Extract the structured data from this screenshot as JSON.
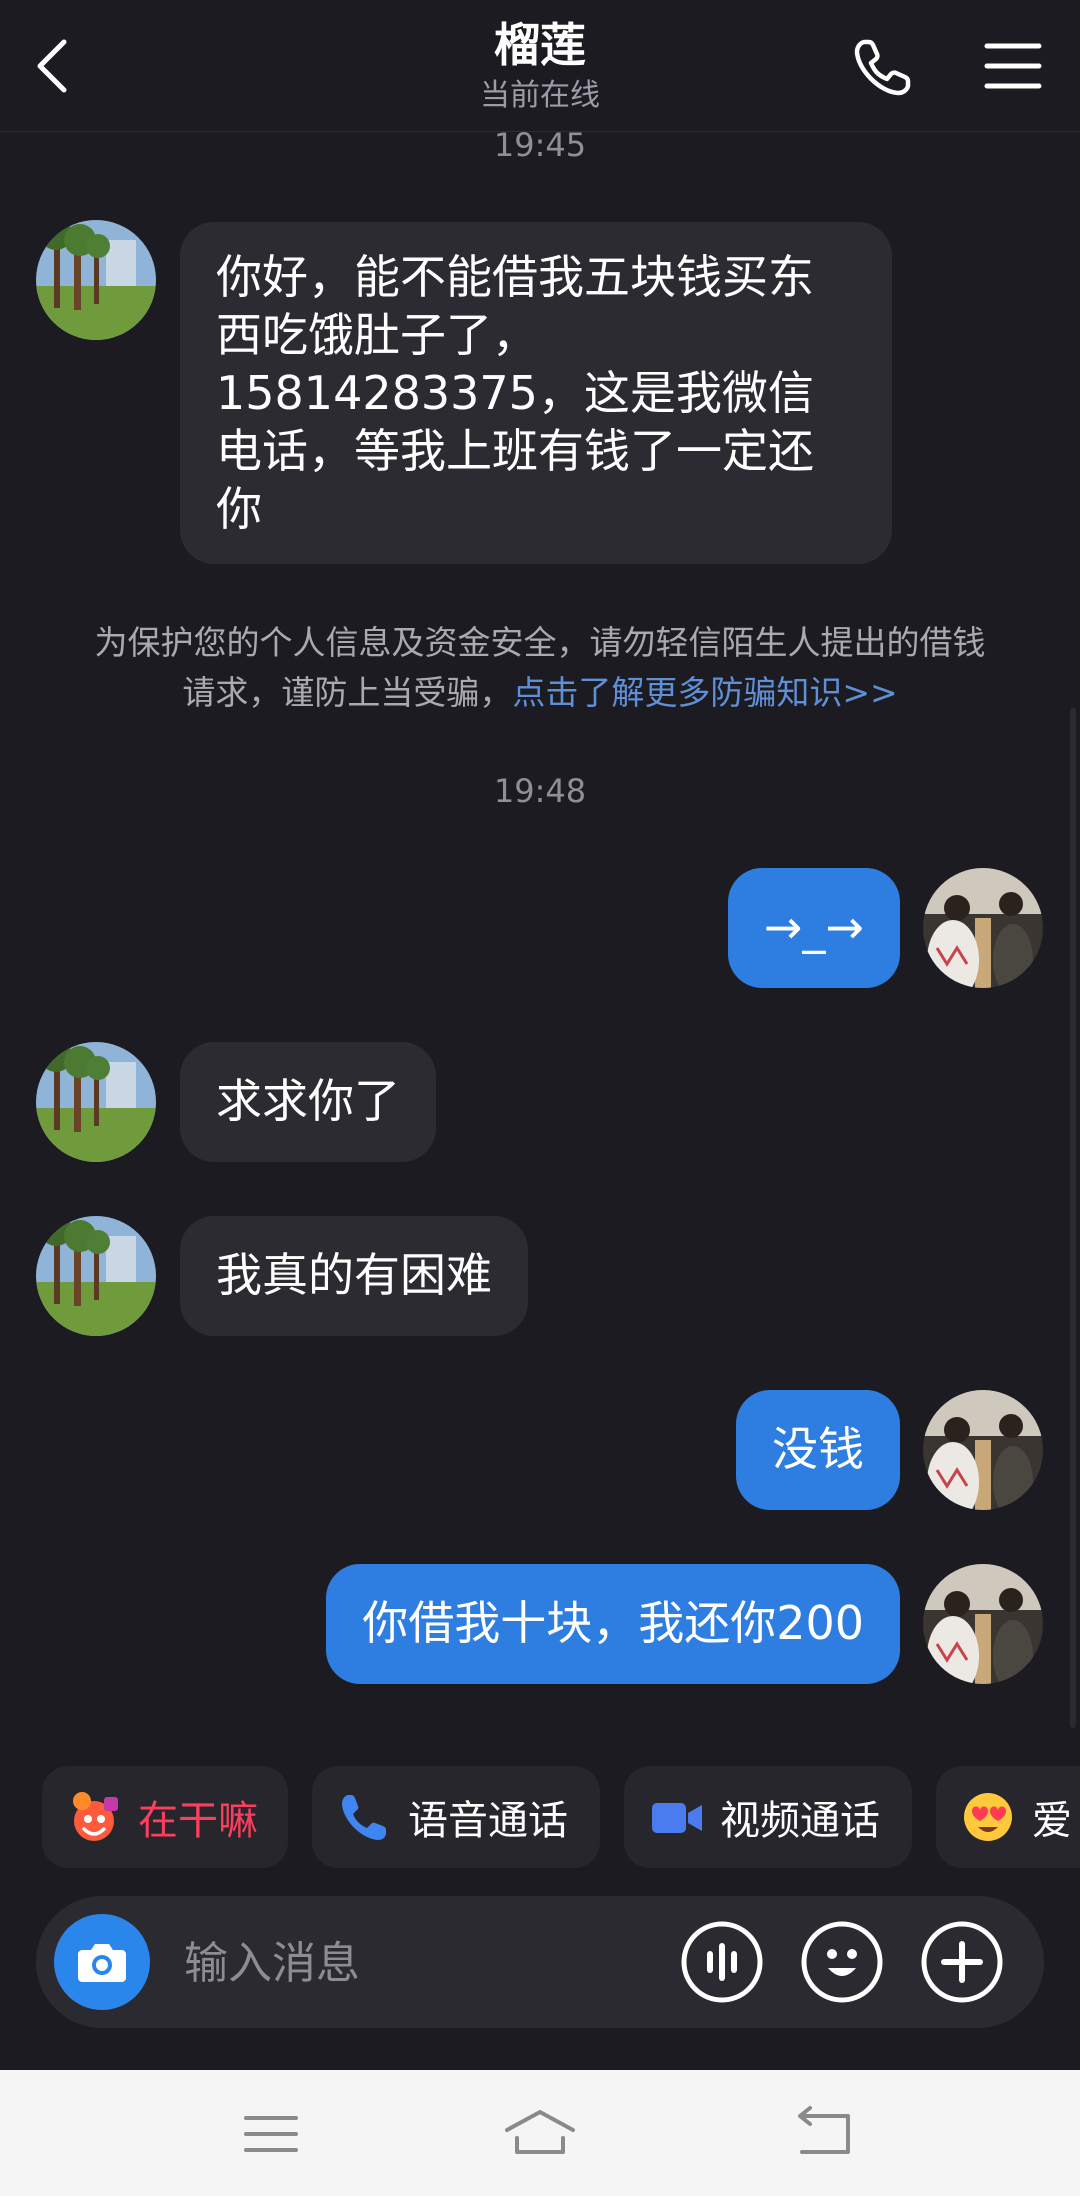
{
  "header": {
    "title": "榴莲",
    "status": "当前在线",
    "back_icon": "chevron-left-icon",
    "call_icon": "phone-icon",
    "menu_icon": "hamburger-menu-icon"
  },
  "chat": {
    "time1": "19:45",
    "msg1": "你好，能不能借我五块钱买东西吃饿肚子了，15814283375，这是我微信电话，等我上班有钱了一定还你",
    "notice_text": "为保护您的个人信息及资金安全，请勿轻信陌生人提出的借钱请求，谨防上当受骗，",
    "notice_link": "点击了解更多防骗知识>>",
    "time2": "19:48",
    "msg2": "→_→",
    "msg3": "求求你了",
    "msg4": "我真的有困难",
    "msg5": "没钱",
    "msg6": "你借我十块，我还你200"
  },
  "quick_actions": [
    {
      "label": "在干嘛",
      "icon": "smile-sticker-icon",
      "color": "#ff3d5e"
    },
    {
      "label": "语音通话",
      "icon": "phone-icon",
      "color": "#ffffff"
    },
    {
      "label": "视频通话",
      "icon": "video-camera-icon",
      "color": "#ffffff"
    },
    {
      "label": "爱",
      "icon": "heart-eyes-emoji-icon",
      "color": "#ffffff"
    }
  ],
  "input": {
    "placeholder": "输入消息",
    "camera_icon": "camera-icon",
    "voice_icon": "voice-wave-icon",
    "emoji_icon": "emoji-icon",
    "more_icon": "plus-icon"
  },
  "colors": {
    "background": "#1b1b21",
    "incoming_bubble": "#2b2b31",
    "outgoing_bubble": "#2e7de1",
    "link": "#5f8fd6",
    "accent_pink": "#ff3d5e"
  },
  "system_nav": [
    "menu-icon",
    "home-icon",
    "back-icon"
  ]
}
